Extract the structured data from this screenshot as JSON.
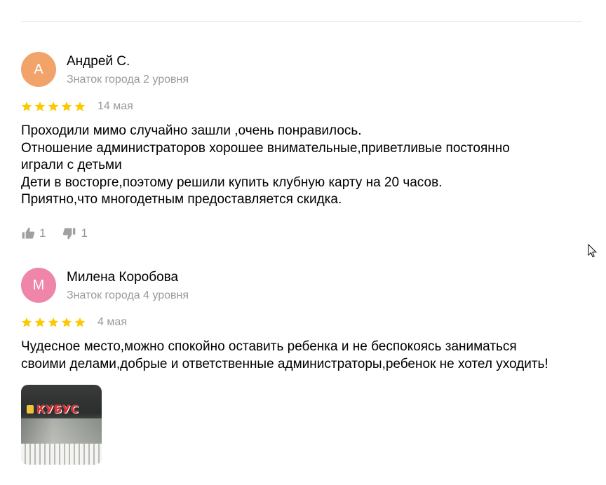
{
  "reviews": [
    {
      "avatar_letter": "А",
      "avatar_color": "#f2a36a",
      "name": "Андрей С.",
      "level": "Знаток города 2 уровня",
      "rating": 5,
      "date": "14 мая",
      "text_lines": [
        "Проходили мимо случайно зашли ,очень понравилось.",
        "Отношение администраторов хорошее внимательные,приветливые постоянно",
        "играли с детьми",
        "Дети в восторге,поэтому решили купить клубную карту на 20 часов.",
        "Приятно,что многодетным предоставляется скидка."
      ],
      "likes": "1",
      "dislikes": "1"
    },
    {
      "avatar_letter": "М",
      "avatar_color": "#ef85a8",
      "name": "Милена Коробова",
      "level": "Знаток города 4 уровня",
      "rating": 5,
      "date": "4 мая",
      "text_lines": [
        "Чудесное место,можно спокойно оставить ребенка и не беспокоясь заниматься",
        "своими делами,добрые и ответственные администраторы,ребенок не хотел уходить!"
      ],
      "photo_sign": "КУБУС"
    }
  ],
  "colors": {
    "star": "#fcc800",
    "muted": "#999999"
  },
  "icons": [
    "star-icon",
    "thumbs-up-icon",
    "thumbs-down-icon",
    "mouse-cursor-icon"
  ]
}
